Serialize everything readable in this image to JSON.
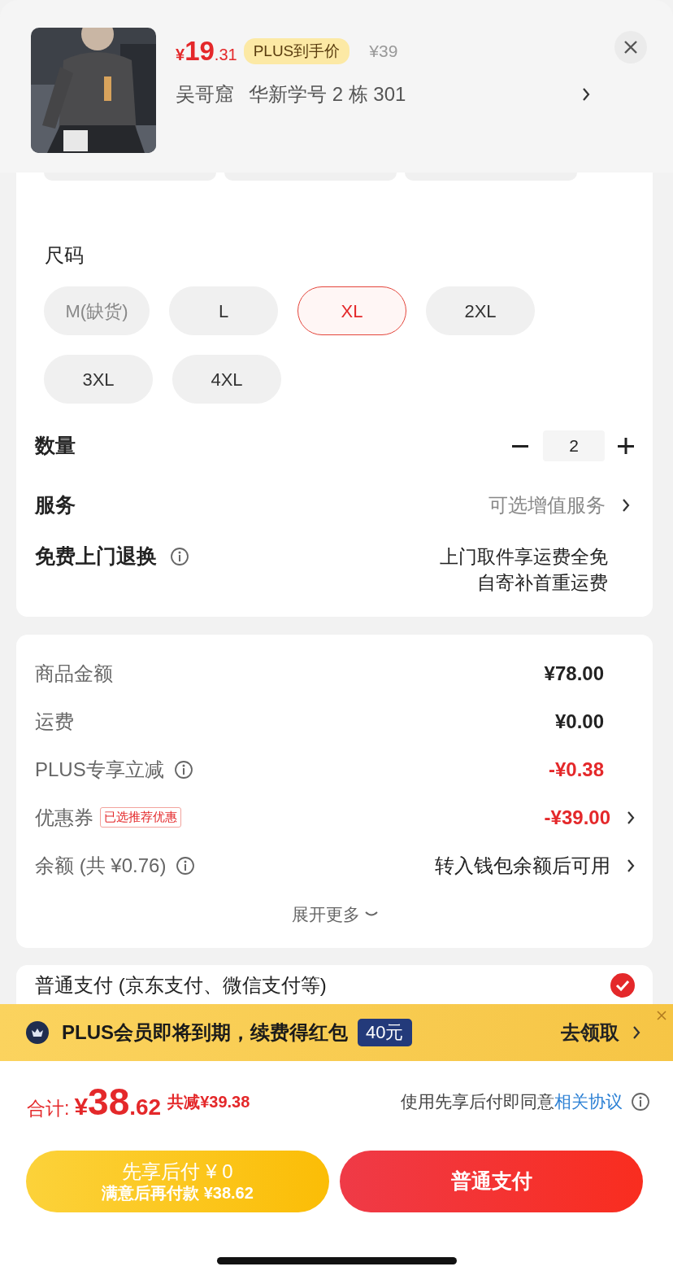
{
  "product": {
    "currency": "¥",
    "price_int": "19",
    "price_dec": ".31",
    "plus_tag": "PLUS到手价",
    "original_price": "¥39",
    "recipient": "吴哥窟",
    "address": "华新学号 2 栋 301"
  },
  "size": {
    "label": "尺码",
    "options": [
      {
        "label": "M(缺货)",
        "disabled": true,
        "selected": false
      },
      {
        "label": "L",
        "disabled": false,
        "selected": false
      },
      {
        "label": "XL",
        "disabled": false,
        "selected": true
      },
      {
        "label": "2XL",
        "disabled": false,
        "selected": false
      },
      {
        "label": "3XL",
        "disabled": false,
        "selected": false
      },
      {
        "label": "4XL",
        "disabled": false,
        "selected": false
      }
    ]
  },
  "quantity": {
    "label": "数量",
    "value": "2"
  },
  "service": {
    "label": "服务",
    "value": "可选增值服务"
  },
  "free_return": {
    "label": "免费上门退换",
    "lines": [
      "上门取件享运费全免",
      "自寄补首重运费"
    ]
  },
  "summary": {
    "rows": [
      {
        "label": "商品金额",
        "value": "¥78.00",
        "kind": "plain",
        "info": false,
        "chevron": false
      },
      {
        "label": "运费",
        "value": "¥0.00",
        "kind": "plain",
        "info": false,
        "chevron": false
      },
      {
        "label": "PLUS专享立减",
        "value": "-¥0.38",
        "kind": "discount",
        "info": true,
        "chevron": false
      },
      {
        "label": "优惠券",
        "tag": "已选推荐优惠",
        "value": "-¥39.00",
        "kind": "discount",
        "info": false,
        "chevron": true
      },
      {
        "label": "余额 (共 ¥0.76)",
        "value": "转入钱包余额后可用",
        "kind": "note",
        "info": true,
        "chevron": true
      }
    ],
    "expand": "展开更多"
  },
  "payment": {
    "label": "普通支付 (京东支付、微信支付等)",
    "selected": true
  },
  "banner": {
    "text": "PLUS会员即将到期，续费得红包",
    "badge": "40元",
    "action": "去领取"
  },
  "footer": {
    "total_label": "合计:",
    "currency": "¥",
    "total_int": "38",
    "total_dec": ".62",
    "saved": "共减¥39.38",
    "agree": "使用先享后付即同意",
    "agree_link": "相关协议",
    "bnpl_title": "先享后付 ¥ 0",
    "bnpl_sub": "满意后再付款 ¥38.62",
    "pay": "普通支付"
  }
}
